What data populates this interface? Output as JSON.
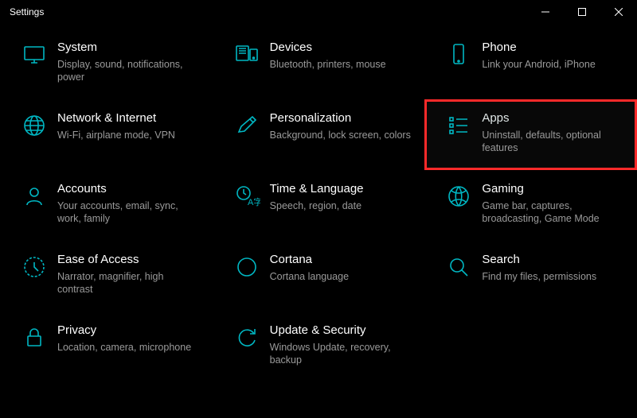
{
  "window": {
    "title": "Settings"
  },
  "accent_color": "#00b7c3",
  "highlight_color": "#ff2a2a",
  "tiles": [
    {
      "id": "system",
      "title": "System",
      "desc": "Display, sound, notifications, power",
      "highlighted": false
    },
    {
      "id": "devices",
      "title": "Devices",
      "desc": "Bluetooth, printers, mouse",
      "highlighted": false
    },
    {
      "id": "phone",
      "title": "Phone",
      "desc": "Link your Android, iPhone",
      "highlighted": false
    },
    {
      "id": "network",
      "title": "Network & Internet",
      "desc": "Wi-Fi, airplane mode, VPN",
      "highlighted": false
    },
    {
      "id": "personalization",
      "title": "Personalization",
      "desc": "Background, lock screen, colors",
      "highlighted": false
    },
    {
      "id": "apps",
      "title": "Apps",
      "desc": "Uninstall, defaults, optional features",
      "highlighted": true
    },
    {
      "id": "accounts",
      "title": "Accounts",
      "desc": "Your accounts, email, sync, work, family",
      "highlighted": false
    },
    {
      "id": "time",
      "title": "Time & Language",
      "desc": "Speech, region, date",
      "highlighted": false
    },
    {
      "id": "gaming",
      "title": "Gaming",
      "desc": "Game bar, captures, broadcasting, Game Mode",
      "highlighted": false
    },
    {
      "id": "ease",
      "title": "Ease of Access",
      "desc": "Narrator, magnifier, high contrast",
      "highlighted": false
    },
    {
      "id": "cortana",
      "title": "Cortana",
      "desc": "Cortana language",
      "highlighted": false
    },
    {
      "id": "search",
      "title": "Search",
      "desc": "Find my files, permissions",
      "highlighted": false
    },
    {
      "id": "privacy",
      "title": "Privacy",
      "desc": "Location, camera, microphone",
      "highlighted": false
    },
    {
      "id": "update",
      "title": "Update & Security",
      "desc": "Windows Update, recovery, backup",
      "highlighted": false
    }
  ]
}
